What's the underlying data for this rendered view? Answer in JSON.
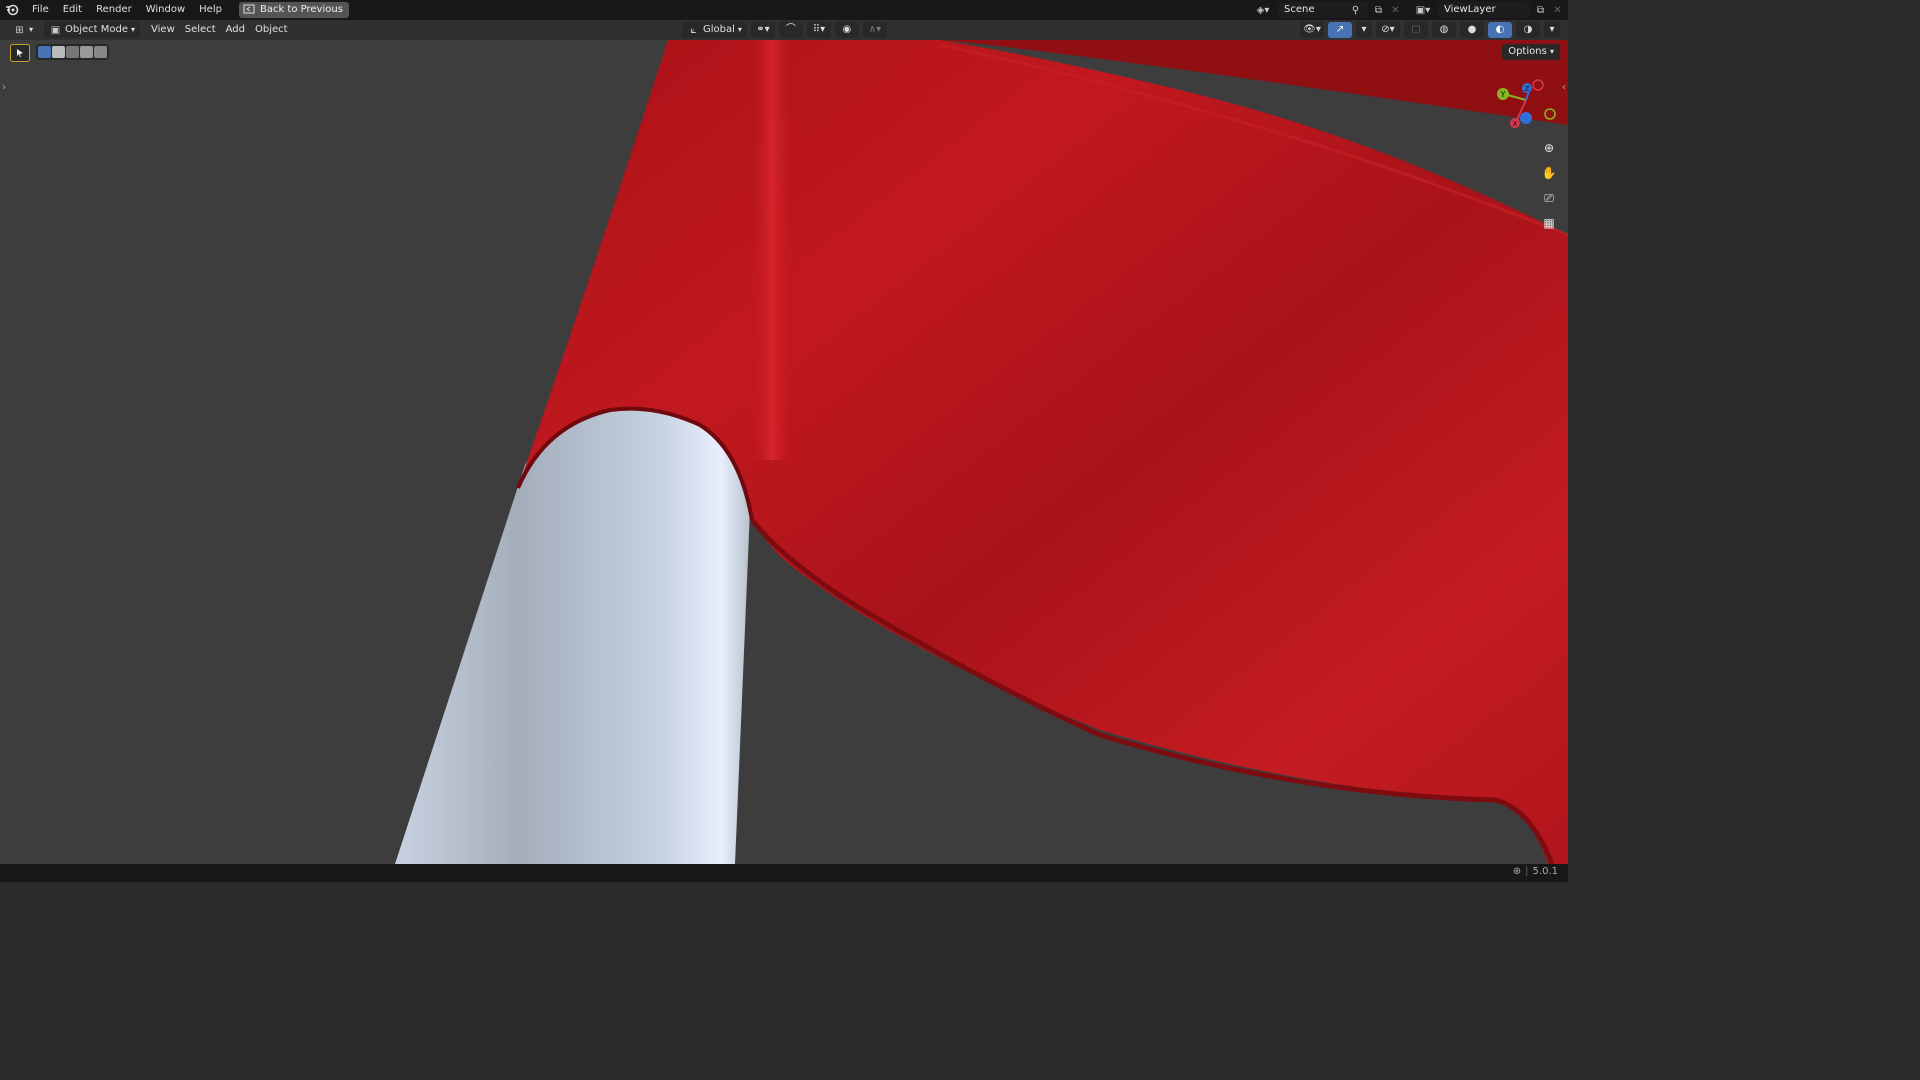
{
  "menu": {
    "file": "File",
    "edit": "Edit",
    "render": "Render",
    "window": "Window",
    "help": "Help",
    "back": "Back to Previous"
  },
  "topbar": {
    "scene_name": "Scene",
    "view_layer": "ViewLayer"
  },
  "header": {
    "mode": "Object Mode",
    "view": "View",
    "select": "Select",
    "add": "Add",
    "object": "Object",
    "orientation": "Global"
  },
  "viewport": {
    "options_label": "Options",
    "gizmo_axes": {
      "x": "X",
      "y": "Y",
      "z": "Z"
    },
    "colors": {
      "flag": "#c0171d",
      "pole": "#c4ccd8",
      "background": "#3d3d3d"
    }
  },
  "status": {
    "version": "5.0.1"
  },
  "icons": [
    "blender-logo-icon",
    "back-icon",
    "scene-icon",
    "pin-icon",
    "viewlayer-icon",
    "editor-type-icon",
    "object-mode-icon",
    "pivot-icon",
    "snap-icon",
    "proportional-icon",
    "zoom-icon",
    "hand-icon",
    "camera-icon",
    "grid-icon",
    "globe-icon"
  ]
}
